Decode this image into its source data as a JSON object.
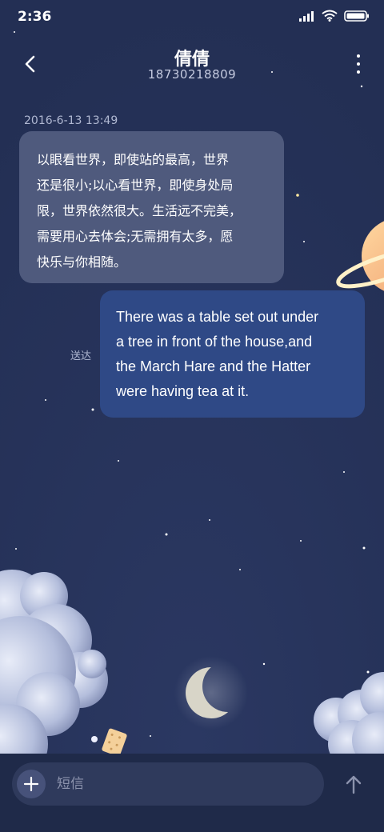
{
  "status_bar": {
    "time": "2:36"
  },
  "header": {
    "contact_name": "倩倩",
    "phone": "18730218809"
  },
  "messages": [
    {
      "direction": "incoming",
      "timestamp": "2016-6-13 13:49",
      "lines": [
        "以眼看世界，即使站的最高，世界",
        "还是很小;以心看世界，即使身处局",
        "限，世界依然很大。生活远不完美，",
        "需要用心去体会;无需拥有太多，愿",
        "快乐与你相随。"
      ]
    },
    {
      "direction": "outgoing",
      "status": "送达",
      "lines": [
        "There was a table set out under",
        "a tree in front of the house,and",
        "the March Hare and the Hatter",
        "were having tea at it."
      ]
    }
  ],
  "composer": {
    "placeholder": "短信"
  },
  "colors": {
    "background": "#253257",
    "incoming_bubble": "#4f5a7d",
    "outgoing_bubble": "#2f4986"
  }
}
